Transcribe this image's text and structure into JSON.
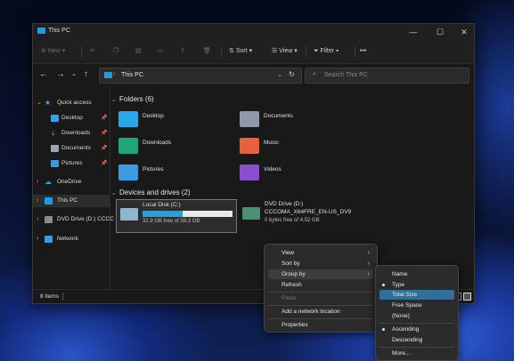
{
  "window": {
    "title": "This PC",
    "minimize": "—",
    "maximize": "☐",
    "close": "✕"
  },
  "toolbar": {
    "new_label": "New",
    "sort_label": "Sort",
    "view_label": "View",
    "filter_label": "Filter",
    "more_label": "•••"
  },
  "address": {
    "path": "This PC",
    "search_placeholder": "Search This PC"
  },
  "sidebar": {
    "items": [
      {
        "label": "Quick access"
      },
      {
        "label": "Desktop"
      },
      {
        "label": "Downloads"
      },
      {
        "label": "Documents"
      },
      {
        "label": "Pictures"
      },
      {
        "label": "OneDrive"
      },
      {
        "label": "This PC"
      },
      {
        "label": "DVD Drive (D:) CCCC"
      },
      {
        "label": "Network"
      }
    ]
  },
  "folders_section": "Folders (6)",
  "folders": [
    {
      "label": "Desktop",
      "color": "#2aa7e8"
    },
    {
      "label": "Documents",
      "color": "#8e9aab"
    },
    {
      "label": "Downloads",
      "color": "#1fa67a"
    },
    {
      "label": "Music",
      "color": "#e8603c"
    },
    {
      "label": "Pictures",
      "color": "#3a9be0"
    },
    {
      "label": "Videos",
      "color": "#8a4fd0"
    }
  ],
  "drives_section": "Devices and drives (2)",
  "drives": [
    {
      "name": "Local Disk (C:)",
      "free": "32.9 GB free of 59.3 GB",
      "used_fraction": 0.45
    },
    {
      "name": "DVD Drive (D:)",
      "label": "CCCOMA_X64FRE_EN-US_DV9",
      "free": "0 bytes free of 4.52 GB"
    }
  ],
  "status": {
    "items": "8 items"
  },
  "context_menu": {
    "items": [
      {
        "label": "View"
      },
      {
        "label": "Sort by"
      },
      {
        "label": "Group by"
      },
      {
        "label": "Refresh"
      },
      {
        "label": "Paste"
      },
      {
        "label": "Add a network location"
      },
      {
        "label": "Properties"
      }
    ]
  },
  "submenu": {
    "items": [
      {
        "label": "Name"
      },
      {
        "label": "Type"
      },
      {
        "label": "Total Size"
      },
      {
        "label": "Free Space"
      },
      {
        "label": "(None)"
      },
      {
        "label": "Ascending"
      },
      {
        "label": "Descending"
      },
      {
        "label": "More..."
      }
    ]
  },
  "colors": {
    "accent": "#26a0da",
    "highlight": "#2f6f98"
  }
}
